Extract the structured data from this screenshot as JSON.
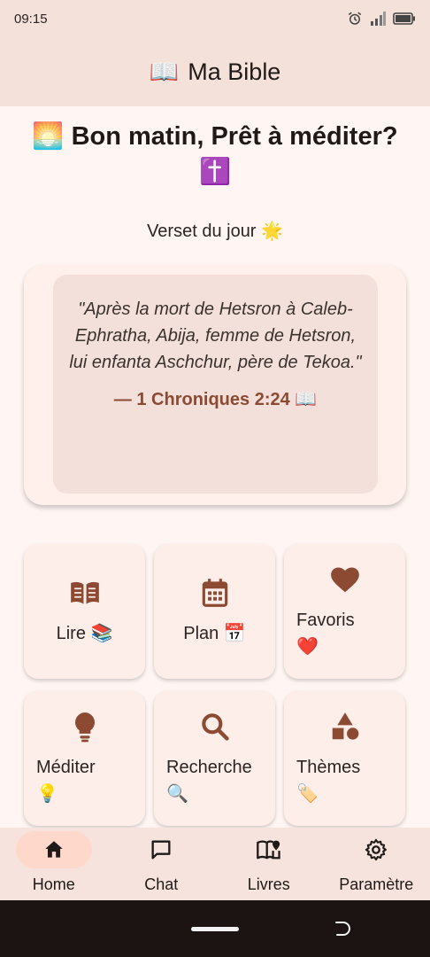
{
  "status_bar": {
    "time": "09:15"
  },
  "app_bar": {
    "icon": "📖",
    "title": "Ma Bible"
  },
  "greeting": {
    "text": "🌅 Bon matin, Prêt à méditer? ✝️"
  },
  "verse_of_day": {
    "label": "Verset du jour 🌟",
    "text": "\"Après la mort de Hetsron à Caleb-Ephratha, Abija, femme de Hetsron, lui enfanta Aschchur, père de Tekoa.\"",
    "reference": "— 1 Chroniques 2:24 📖"
  },
  "actions": [
    {
      "label": "Lire 📚",
      "icon": "book-open-icon"
    },
    {
      "label": "Plan 📅",
      "icon": "calendar-icon"
    },
    {
      "label": "Favoris",
      "emoji": "❤️",
      "icon": "heart-icon"
    },
    {
      "label": "Méditer",
      "emoji": "💡",
      "icon": "lightbulb-icon"
    },
    {
      "label": "Recherche",
      "emoji": "🔍",
      "icon": "search-icon"
    },
    {
      "label": "Thèmes",
      "emoji": "🏷️",
      "icon": "shapes-icon"
    }
  ],
  "bottom_nav": [
    {
      "label": "Home",
      "icon": "home-icon",
      "active": true
    },
    {
      "label": "Chat",
      "icon": "chat-icon",
      "active": false
    },
    {
      "label": "Livres",
      "icon": "book-map-icon",
      "active": false
    },
    {
      "label": "Paramètre",
      "icon": "gear-icon",
      "active": false
    }
  ],
  "colors": {
    "accent": "#8c4a32",
    "bar": "#f3e1da",
    "background": "#fff6f3",
    "active_pill": "#ffd8cc"
  }
}
